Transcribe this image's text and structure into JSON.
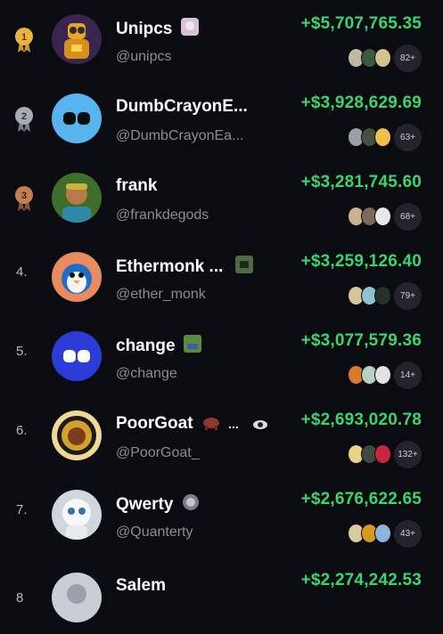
{
  "rows": [
    {
      "rank": "1",
      "rank_style": "gold",
      "name": "Unipcs",
      "handle": "@unipcs",
      "amount": "+$5,707,765.35",
      "count": "82+",
      "avatar": "robot",
      "thumbs": [
        "#bdb9a3",
        "#3a5b3a",
        "#d2c38f"
      ],
      "has_badge": true,
      "badge_color": "#d8c1d8"
    },
    {
      "rank": "2",
      "rank_style": "silver",
      "name": "DumbCrayonE...",
      "handle": "@DumbCrayonEa...",
      "amount": "+$3,928,629.69",
      "count": "63+",
      "avatar": "blue-chain",
      "thumbs": [
        "#9aa0a8",
        "#44523d",
        "#efc14a"
      ],
      "has_badge": false
    },
    {
      "rank": "3",
      "rank_style": "bronze",
      "name": "frank",
      "handle": "@frankdegods",
      "amount": "+$3,281,745.60",
      "count": "68+",
      "avatar": "frank",
      "thumbs": [
        "#c8b58f",
        "#7a6b58",
        "#e8e8e8"
      ],
      "has_badge": false
    },
    {
      "rank": "4.",
      "rank_style": "plain",
      "name": "Ethermonk ...",
      "handle": "@ether_monk",
      "amount": "+$3,259,126.40",
      "count": "79+",
      "avatar": "penguin",
      "thumbs": [
        "#d6c59a",
        "#8fc2cf",
        "#26302a"
      ],
      "has_badge": true,
      "badge_color": "#4e6b45"
    },
    {
      "rank": "5.",
      "rank_style": "plain",
      "name": "change",
      "handle": "@change",
      "amount": "+$3,077,579.36",
      "count": "14+",
      "avatar": "blue-dark-chain",
      "thumbs": [
        "#d97b2c",
        "#b7d0c1",
        "#e2e2e2"
      ],
      "has_badge": true,
      "badge_color": "#5b8a3c"
    },
    {
      "rank": "6.",
      "rank_style": "plain",
      "name": "PoorGoat",
      "handle": "@PoorGoat_",
      "amount": "+$2,693,020.78",
      "count": "132+",
      "avatar": "goat",
      "thumbs": [
        "#e8d28a",
        "#3f4a3f",
        "#c7253c"
      ],
      "has_badge": true,
      "badge_color": "#8a3a2a"
    },
    {
      "rank": "7.",
      "rank_style": "plain",
      "name": "Qwerty",
      "handle": "@Quanterty",
      "amount": "+$2,676,622.65",
      "count": "43+",
      "avatar": "white-bot",
      "thumbs": [
        "#d9c9a0",
        "#d79a1e",
        "#8fb4d9"
      ],
      "has_badge": true,
      "badge_color": "#7a7f87"
    },
    {
      "rank": "8",
      "rank_style": "plain",
      "name": "Salem",
      "handle": "",
      "amount": "+$2,274,242.53",
      "count": "",
      "avatar": "grey",
      "thumbs": [],
      "has_badge": false
    }
  ]
}
